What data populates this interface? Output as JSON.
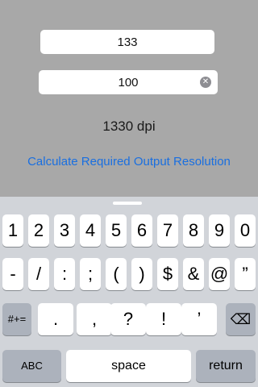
{
  "form": {
    "field1_value": "133",
    "field2_value": "100",
    "clear_glyph": "✕",
    "result": "1330 dpi",
    "calc_label": "Calculate Required Output Resolution"
  },
  "keyboard": {
    "row1": [
      "1",
      "2",
      "3",
      "4",
      "5",
      "6",
      "7",
      "8",
      "9",
      "0"
    ],
    "row2": [
      "-",
      "/",
      ":",
      ";",
      "(",
      ")",
      "$",
      "&",
      "@",
      "”"
    ],
    "row3_mode": "#+=",
    "row3": [
      ".",
      ",",
      "?",
      "!",
      "’"
    ],
    "backspace_glyph": "⌫",
    "row4_abc": "ABC",
    "row4_space": "space",
    "row4_return": "return"
  }
}
